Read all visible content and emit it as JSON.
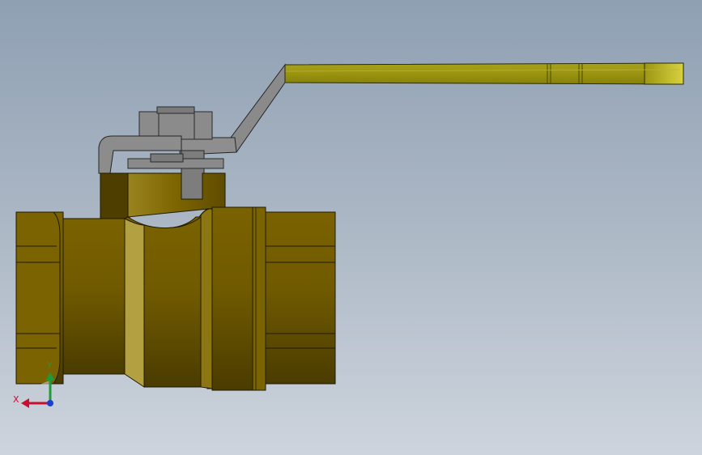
{
  "triad": {
    "x_label": "X",
    "y_label": "Y",
    "colors": {
      "x": "#c8102e",
      "y": "#1f9a3a",
      "z": "#1a3fd1"
    }
  },
  "colors": {
    "brass": "#7a6400",
    "brass_dark": "#5e4d00",
    "handle": "#a39a12",
    "stem_gray": "#8f8f8f"
  }
}
